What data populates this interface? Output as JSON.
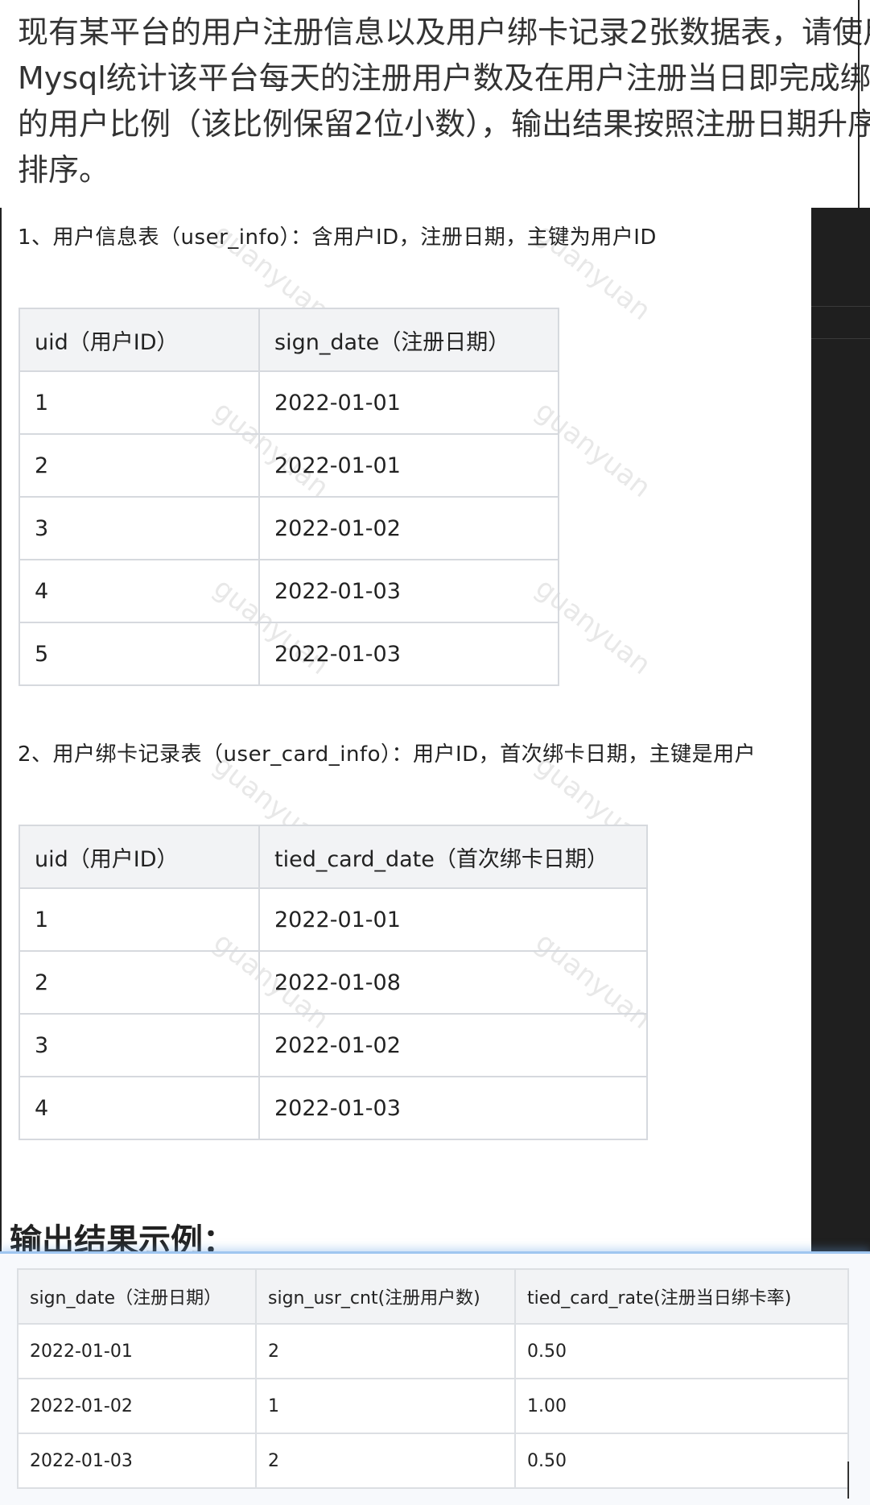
{
  "question": {
    "lines": [
      "现有某平台的用户注册信息以及用户绑卡记录2张数据表，请使用",
      "Mysql统计该平台每天的注册用户数及在用户注册当日即完成绑卡",
      "的用户比例（该比例保留2位小数），输出结果按照注册日期升序",
      "排序。"
    ]
  },
  "table1": {
    "title": "1、用户信息表（user_info）：含用户ID，注册日期，主键为用户ID",
    "headers": [
      "uid（用户ID）",
      "sign_date（注册日期）"
    ],
    "rows": [
      [
        "1",
        "2022-01-01"
      ],
      [
        "2",
        "2022-01-01"
      ],
      [
        "3",
        "2022-01-02"
      ],
      [
        "4",
        "2022-01-03"
      ],
      [
        "5",
        "2022-01-03"
      ]
    ]
  },
  "table2": {
    "title": "2、用户绑卡记录表（user_card_info）：用户ID，首次绑卡日期，主键是用户",
    "headers": [
      "uid（用户ID）",
      "tied_card_date（首次绑卡日期）"
    ],
    "rows": [
      [
        "1",
        "2022-01-01"
      ],
      [
        "2",
        "2022-01-08"
      ],
      [
        "3",
        "2022-01-02"
      ],
      [
        "4",
        "2022-01-03"
      ]
    ]
  },
  "output": {
    "heading": "输出结果示例：",
    "headers": [
      "sign_date（注册日期）",
      "sign_usr_cnt(注册用户数)",
      "tied_card_rate(注册当日绑卡率)"
    ],
    "rows": [
      [
        "2022-01-01",
        "2",
        "0.50"
      ],
      [
        "2022-01-02",
        "1",
        "1.00"
      ],
      [
        "2022-01-03",
        "2",
        "0.50"
      ]
    ]
  },
  "watermark_text": "guanyuan"
}
